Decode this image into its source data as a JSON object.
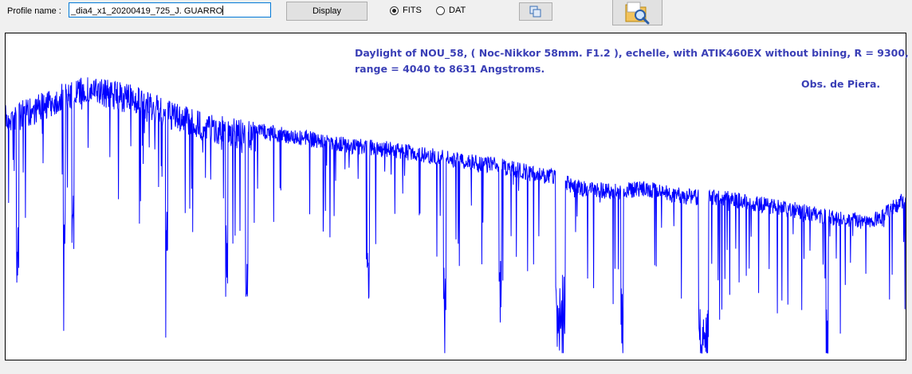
{
  "toolbar": {
    "profile_label": "Profile name :",
    "profile_value": "_dia4_x1_20200419_725_J. GUARRO",
    "display_button": "Display",
    "radio_fits": "FITS",
    "radio_dat": "DAT",
    "selected_format": "FITS",
    "copy_icon": "copy-icon",
    "search_icon": "folder-search-icon"
  },
  "plot": {
    "line_color": "#0000ff",
    "annotation_color": "#3a3fb6",
    "annotation_line1": "Daylight of NOU_58, ( Noc-Nikkor 58mm. F1.2 ), echelle, with ATIK460EX without bining, R = 9300,",
    "annotation_line2": "range = 4040 to 8631 Angstroms.",
    "annotation_line3": "Obs. de Piera."
  },
  "chart_data": {
    "type": "line",
    "title": "",
    "xlabel": "",
    "ylabel": "",
    "xlim": [
      4040,
      8631
    ],
    "ylim": [
      0,
      1
    ],
    "grid": false,
    "series": [
      {
        "values_shape": "solar daylight spectrum envelope",
        "x": [
          4040,
          4150,
          4300,
          4450,
          4560,
          4700,
          4850,
          5050,
          5200,
          5400,
          5600,
          5800,
          6000,
          6200,
          6400,
          6550,
          6700,
          6860,
          6950,
          7150,
          7300,
          7450,
          7590,
          7700,
          7900,
          8100,
          8250,
          8400,
          8500,
          8631
        ],
        "y": [
          0.78,
          0.8,
          0.84,
          0.87,
          0.86,
          0.84,
          0.8,
          0.76,
          0.74,
          0.72,
          0.7,
          0.68,
          0.67,
          0.65,
          0.63,
          0.62,
          0.6,
          0.58,
          0.55,
          0.54,
          0.55,
          0.53,
          0.52,
          0.52,
          0.5,
          0.48,
          0.46,
          0.45,
          0.46,
          0.52
        ]
      }
    ],
    "absorption_features_angstrom": [
      4101,
      4340,
      4384,
      4861,
      5168,
      5270,
      5890,
      6280,
      6563,
      6870,
      7185,
      7600,
      8230
    ]
  }
}
